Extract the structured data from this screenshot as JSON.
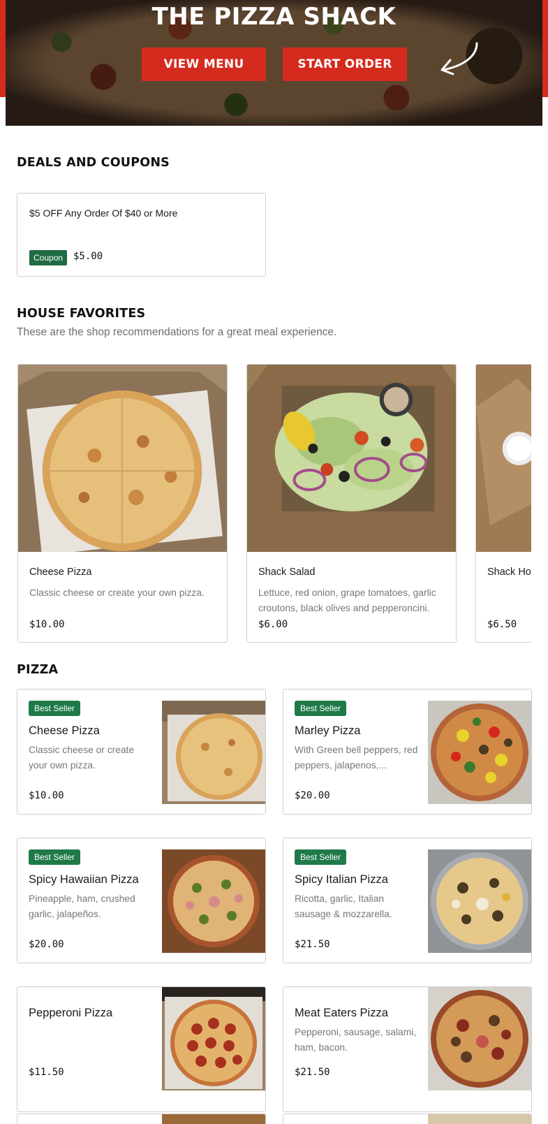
{
  "hero": {
    "title": "THE PIZZA SHACK",
    "view_menu": "VIEW MENU",
    "start_order": "START ORDER"
  },
  "deals": {
    "title": "DEALS AND COUPONS",
    "coupons": [
      {
        "title": "$5 OFF Any Order Of $40 or More",
        "badge": "Coupon",
        "price": "$5.00"
      }
    ]
  },
  "favorites": {
    "title": "HOUSE FAVORITES",
    "subtitle": "These are the shop recommendations for a great meal experience.",
    "items": [
      {
        "name": "Cheese Pizza",
        "description": "Classic cheese or create your own pizza.",
        "price": "$10.00"
      },
      {
        "name": "Shack Salad",
        "description": "Lettuce, red onion, grape tomatoes, garlic croutons, black olives and pepperoncini.",
        "price": "$6.00"
      },
      {
        "name": "Shack Ho",
        "description": "",
        "price": "$6.50"
      }
    ]
  },
  "pizza": {
    "title": "PIZZA",
    "items": [
      {
        "badge": "Best Seller",
        "name": "Cheese Pizza",
        "description": "Classic cheese or create your own pizza.",
        "price": "$10.00"
      },
      {
        "badge": "Best Seller",
        "name": "Marley Pizza",
        "description": "With Green bell peppers, red peppers, jalapenos,...",
        "price": "$20.00"
      },
      {
        "badge": "Best Seller",
        "name": "Spicy Hawaiian Pizza",
        "description": "Pineapple, ham, crushed garlic, jalapeños.",
        "price": "$20.00"
      },
      {
        "badge": "Best Seller",
        "name": "Spicy Italian Pizza",
        "description": "Ricotta, garlic, Italian sausage & mozzarella.",
        "price": "$21.50"
      },
      {
        "badge": "",
        "name": "Pepperoni Pizza",
        "description": "",
        "price": "$11.50"
      },
      {
        "badge": "",
        "name": "Meat Eaters Pizza",
        "description": "Pepperoni, sausage, salami, ham, bacon.",
        "price": "$21.50"
      }
    ]
  },
  "colors": {
    "brand_red": "#d52b1e",
    "badge_green": "#1f7a48",
    "coupon_green": "#1f6b43"
  }
}
